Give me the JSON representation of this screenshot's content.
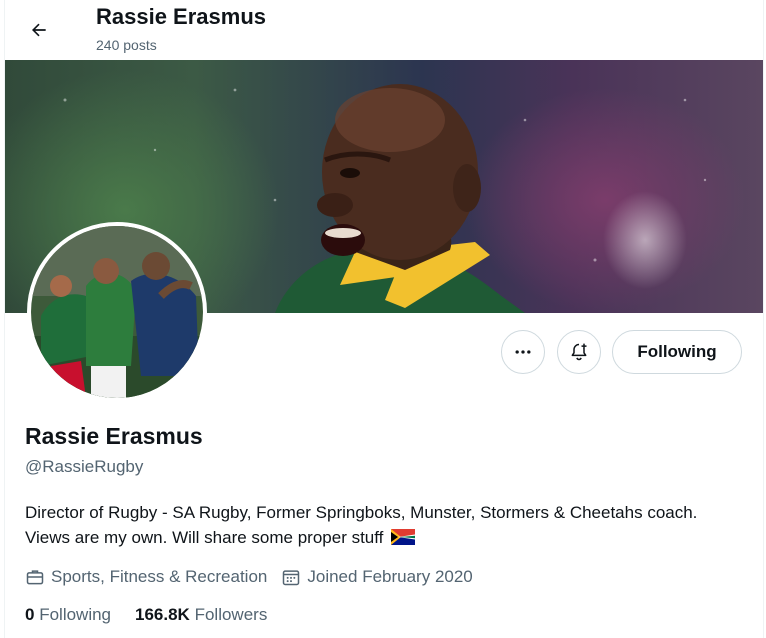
{
  "header": {
    "name": "Rassie Erasmus",
    "posts": "240 posts"
  },
  "icons": {
    "back": "arrow-left-icon",
    "more": "more-horizontal-icon",
    "notify": "bell-plus-icon",
    "category": "briefcase-icon",
    "joined": "calendar-icon",
    "flag": "south-africa-flag-icon"
  },
  "profile": {
    "name": "Rassie Erasmus",
    "handle": "@RassieRugby",
    "bio": "Director of Rugby - SA Rugby, Former Springboks, Munster, Stormers & Cheetahs coach. Views are my own. Will share some proper stuff",
    "category": "Sports, Fitness & Recreation",
    "joined": "Joined February 2020",
    "following_count": "0",
    "following_label": "Following",
    "followers_count": "166.8K",
    "followers_label": "Followers"
  },
  "actions": {
    "following_button": "Following"
  },
  "colors": {
    "text_primary": "#0f1419",
    "text_secondary": "#536471",
    "border": "#cfd9de",
    "jersey_green": "#1f5a35",
    "jersey_gold": "#f2c12e"
  }
}
